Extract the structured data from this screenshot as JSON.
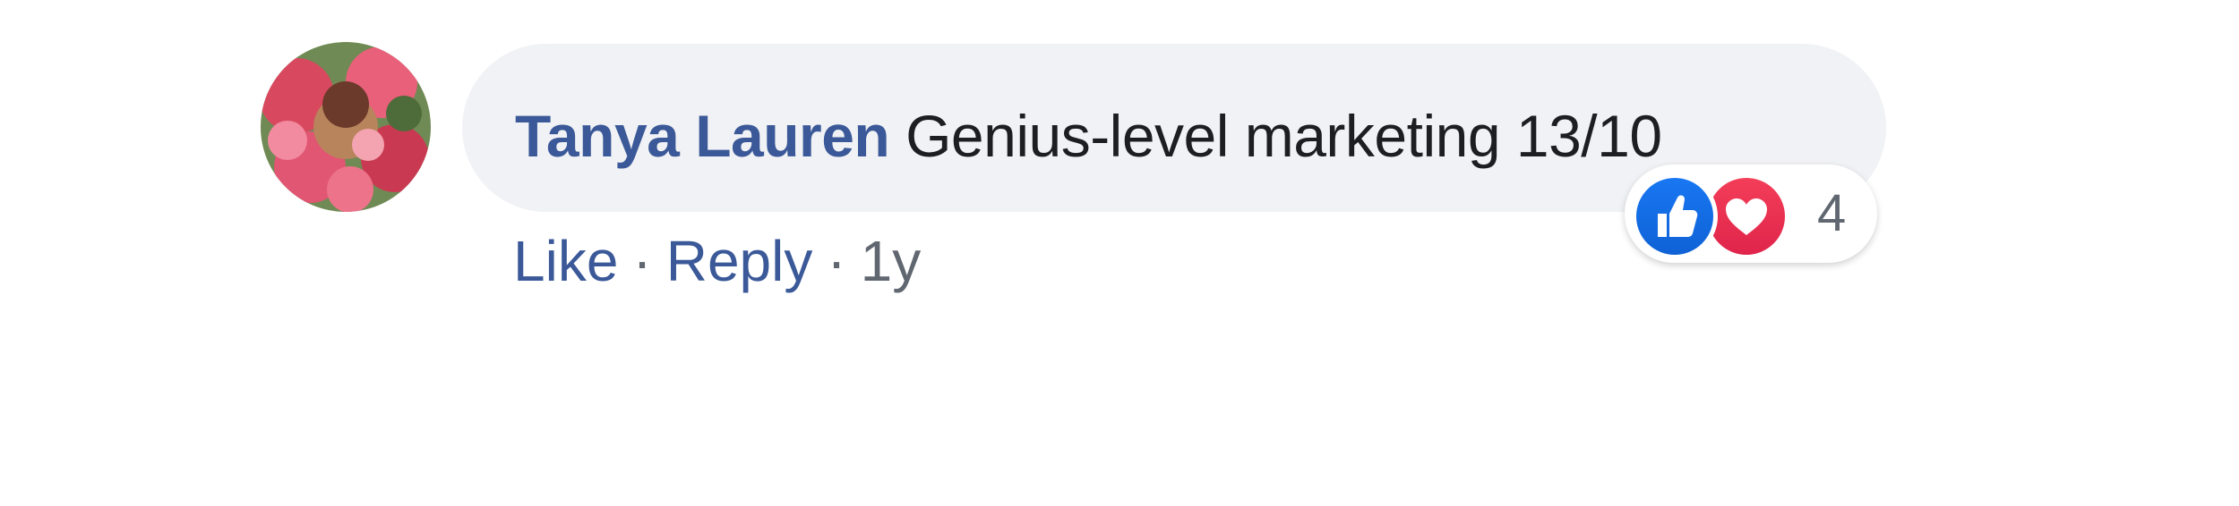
{
  "comment": {
    "author": "Tanya Lauren",
    "text": "Genius-level marketing 13/10",
    "avatar_icon": "avatar-photo",
    "actions": {
      "like_label": "Like",
      "separator": "·",
      "reply_label": "Reply",
      "timestamp": "1y"
    },
    "reactions": {
      "icons": [
        "like-icon",
        "love-icon"
      ],
      "count": "4"
    }
  },
  "colors": {
    "author_link": "#3b5998",
    "bubble_bg": "#f1f2f5",
    "like_blue": "#1877f2",
    "love_red": "#f33e58",
    "meta_gray": "#606770"
  }
}
